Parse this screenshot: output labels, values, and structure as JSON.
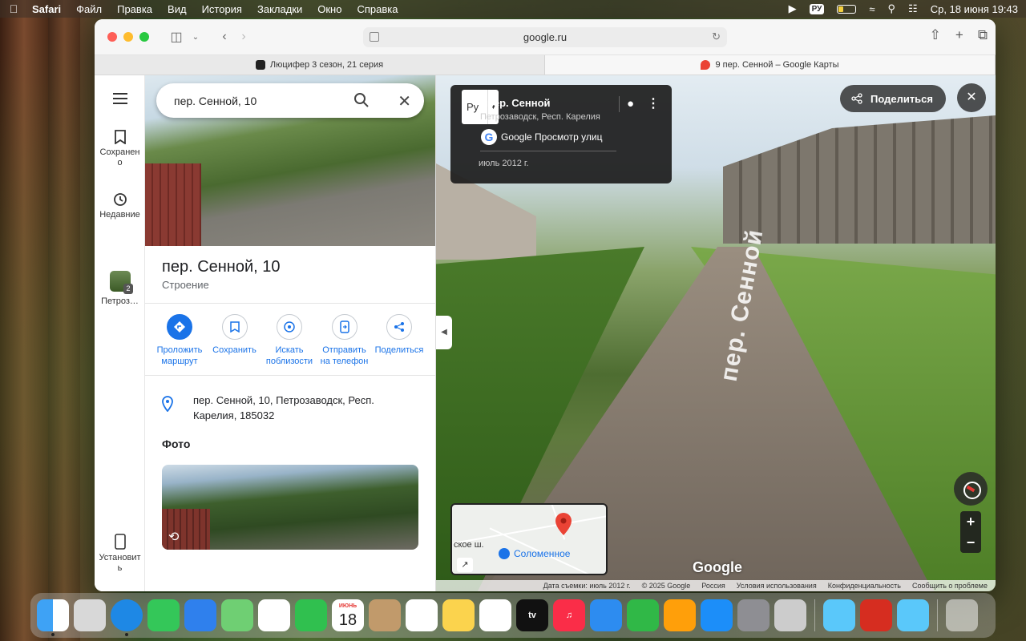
{
  "menubar": {
    "app_name": "Safari",
    "items": [
      "Файл",
      "Правка",
      "Вид",
      "История",
      "Закладки",
      "Окно",
      "Справка"
    ],
    "input_lang": "РУ",
    "datetime": "Ср, 18 июня  19:43"
  },
  "browser": {
    "url": "google.ru",
    "tabs": [
      {
        "title": "Люцифер 3 сезон, 21 серия",
        "active": false
      },
      {
        "title": "9 пер. Сенной – Google Карты",
        "active": true
      }
    ]
  },
  "rail": {
    "menu_icon": "hamburger-icon",
    "items": [
      {
        "label": "Сохранено",
        "icon": "bookmark-icon"
      },
      {
        "label": "Недавние",
        "icon": "history-icon"
      },
      {
        "label": "Петроз…",
        "badge": "2"
      },
      {
        "label": "Установить",
        "icon": "phone-icon"
      }
    ]
  },
  "panel": {
    "search_value": "пер. Сенной, 10",
    "title": "пер. Сенной, 10",
    "subtitle": "Строение",
    "actions": [
      {
        "label": "Проложить маршрут",
        "icon": "directions-icon"
      },
      {
        "label": "Сохранить",
        "icon": "bookmark-icon"
      },
      {
        "label": "Искать поблизости",
        "icon": "nearby-icon"
      },
      {
        "label": "Отправить на телефон",
        "icon": "send-to-phone-icon"
      },
      {
        "label": "Поделиться",
        "icon": "share-icon"
      }
    ],
    "address": "пер. Сенной, 10, Петрозаводск, Респ. Карелия, 185032",
    "photos_heading": "Фото"
  },
  "streetview": {
    "lang_button": "Ру",
    "street_name": "пер. Сенной",
    "region": "Петрозаводск, Респ. Карелия",
    "source": "Google Просмотр улиц",
    "date": "июль 2012 г.",
    "share_label": "Поделиться",
    "road_label": "пер. Сенной",
    "minimap_place": "Соломенное",
    "minimap_cut_label": "ское ш.",
    "google_logo": "Google",
    "footer": [
      "Дата съемки: июль 2012 г.",
      "© 2025 Google",
      "Россия",
      "Условия использования",
      "Конфиденциальность",
      "Сообщить о проблеме"
    ]
  },
  "dock": {
    "calendar_month": "ИЮНЬ",
    "calendar_day": "18",
    "apps": [
      "finder-icon",
      "launchpad-icon",
      "safari-icon",
      "messages-icon",
      "mail-icon",
      "maps-icon",
      "photos-icon",
      "facetime-icon",
      "calendar-icon",
      "contacts-icon",
      "reminders-icon",
      "notes-icon",
      "freeform-icon",
      "tv-icon",
      "music-icon",
      "keynote-icon",
      "numbers-icon",
      "pages-icon",
      "appstore-icon",
      "settings-icon",
      "iphone-mirroring-icon",
      "preview-icon",
      "photo-booth-icon",
      "preview2-icon",
      "trash-icon"
    ]
  },
  "colors": {
    "accent": "#1a73e8",
    "pin_red": "#ea4335"
  }
}
